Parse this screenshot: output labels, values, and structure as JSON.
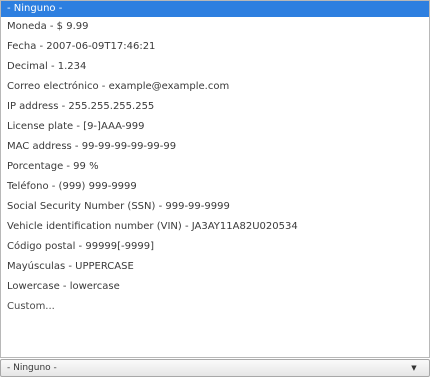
{
  "colors": {
    "selection": "#2d7fe0",
    "selection_text": "#ffffff",
    "text": "#3a3a3a"
  },
  "list": {
    "options": [
      {
        "label": "- Ninguno -"
      },
      {
        "label": "Moneda - $ 9.99"
      },
      {
        "label": "Fecha - 2007-06-09T17:46:21"
      },
      {
        "label": "Decimal - 1.234"
      },
      {
        "label": "Correo electrónico - example@example.com"
      },
      {
        "label": "IP address - 255.255.255.255"
      },
      {
        "label": "License plate - [9-]AAA-999"
      },
      {
        "label": "MAC address - 99-99-99-99-99-99"
      },
      {
        "label": "Porcentage - 99 %"
      },
      {
        "label": "Teléfono - (999) 999-9999"
      },
      {
        "label": "Social Security Number (SSN) - 999-99-9999"
      },
      {
        "label": "Vehicle identification number (VIN) - JA3AY11A82U020534"
      },
      {
        "label": "Código postal - 99999[-9999]"
      },
      {
        "label": "Mayúsculas - UPPERCASE"
      },
      {
        "label": "Lowercase - lowercase"
      },
      {
        "label": "Custom..."
      }
    ]
  },
  "select": {
    "value": "- Ninguno -",
    "arrow_icon": "triangle-down-icon"
  }
}
